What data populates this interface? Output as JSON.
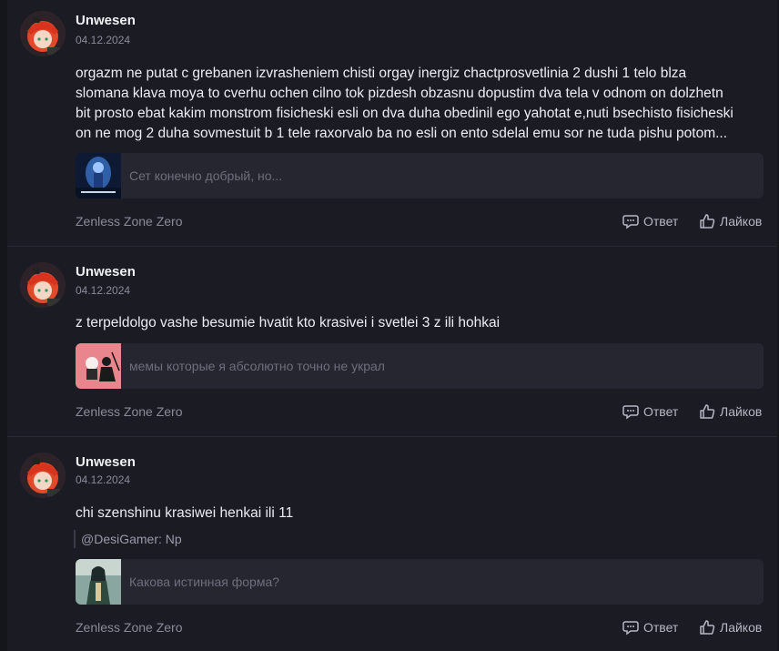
{
  "posts": [
    {
      "author": "Unwesen",
      "date": "04.12.2024",
      "text": "orgazm ne putat c grebanen izvrasheniem chisti orgay inergiz chactprosvetlinia 2 dushi 1 telo blza slomana klava moya to cverhu ochen cilno tok pizdesh obzasnu dopustim dva tela v odnom on dolzhetn bit prosto ebat kakim monstrom fisicheski esli on dva duha obedinil ego yahotat e,nuti bsechisto fisicheski on ne mog 2 duha sovmestuit b 1 tele raxorvalo ba no esli on ento sdelal emu sor ne tuda pishu potom...",
      "quote": "",
      "link_title": "Сет конечно добрый, но...",
      "game": "Zenless Zone Zero",
      "reply_label": "Ответ",
      "like_label": "Лайков"
    },
    {
      "author": "Unwesen",
      "date": "04.12.2024",
      "text": "z terpeldolgo vashe besumie hvatit kto krasivei i svetlei 3 z ili hohkai",
      "quote": "",
      "link_title": "мемы которые я абсолютно точно не украл",
      "game": "Zenless Zone Zero",
      "reply_label": "Ответ",
      "like_label": "Лайков"
    },
    {
      "author": "Unwesen",
      "date": "04.12.2024",
      "text": "chi szenshinu krasiwei henkai ili 11",
      "quote": "@DesiGamer: Np",
      "link_title": "Какова истинная форма?",
      "game": "Zenless Zone Zero",
      "reply_label": "Ответ",
      "like_label": "Лайков"
    }
  ],
  "icons": {
    "avatar": "avatar-red-hair-girl",
    "reply": "comment-bubble-icon",
    "like": "thumbs-up-icon"
  },
  "colors": {
    "background": "#15151c",
    "post_background": "#1b1b24",
    "card_background": "#262631",
    "text": "#ececf2",
    "muted": "#8b8b98"
  }
}
